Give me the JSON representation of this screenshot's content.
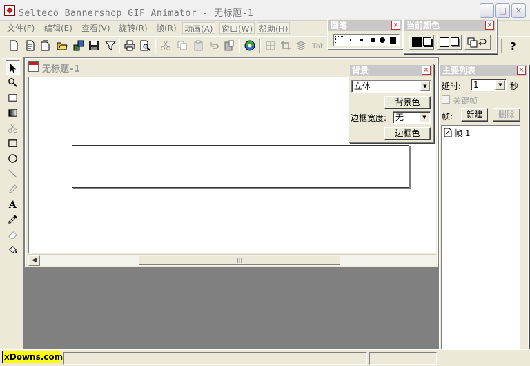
{
  "window": {
    "title": "Selteco Bannershop GIF Animator - 无标题-1"
  },
  "caption_buttons": {
    "minimize": "_",
    "maximize": "□",
    "close": "×"
  },
  "menu": [
    "文件(F)",
    "编辑(E)",
    "查看(V)",
    "旋转(R)",
    "帧(R)",
    "动画(A)",
    "窗口(W)",
    "帮助(H)"
  ],
  "toolbar": {
    "icons": [
      "new-icon",
      "new-template-icon",
      "new-blank-icon",
      "open-icon",
      "import-icon",
      "save-icon",
      "filter-icon",
      "print-icon",
      "print-preview-icon",
      "cut-icon",
      "copy-icon",
      "paste-icon",
      "undo-icon",
      "paste-special-icon",
      "play-icon",
      "grid-icon",
      "crop-icon",
      "layers-icon",
      "text-effect-icon",
      "help-icon"
    ]
  },
  "pen_palette": {
    "title": "画笔",
    "close": "×",
    "sizes": [
      "1",
      "2",
      "3",
      "4",
      "5",
      "6"
    ]
  },
  "color_palette": {
    "title": "当前颜色",
    "close": "×",
    "foreground": "#000000",
    "background": "#ffffff"
  },
  "tools": [
    "select-arrow-icon",
    "zoom-icon",
    "rect-select-icon",
    "gradient-icon",
    "scissors-icon",
    "rectangle-icon",
    "ellipse-icon",
    "line-icon",
    "pencil-icon",
    "text-icon",
    "eyedropper-icon",
    "eraser-icon",
    "fill-icon"
  ],
  "document": {
    "title": "无标题-1",
    "scroll_left": "◀",
    "scroll_grip": "|||"
  },
  "background_panel": {
    "title": "背景",
    "close": "×",
    "style_value": "立体",
    "bg_color_button": "背景色",
    "border_width_label": "边框宽度:",
    "border_width_value": "无",
    "border_color_button": "边框色"
  },
  "frame_panel": {
    "title": "主要列表",
    "close": "×",
    "delay_label": "延时:",
    "delay_value": "1",
    "delay_unit": "秒",
    "keyframe_label": "关键帧",
    "frame_label": "帧:",
    "new_button": "新建",
    "delete_button": "删除",
    "frames": [
      "帧 1"
    ]
  },
  "status": {
    "watermark": "xDowns.com"
  },
  "colors": {
    "face": "#ECE9D8",
    "workspace": "#808080",
    "watermark": "#ffff00"
  }
}
